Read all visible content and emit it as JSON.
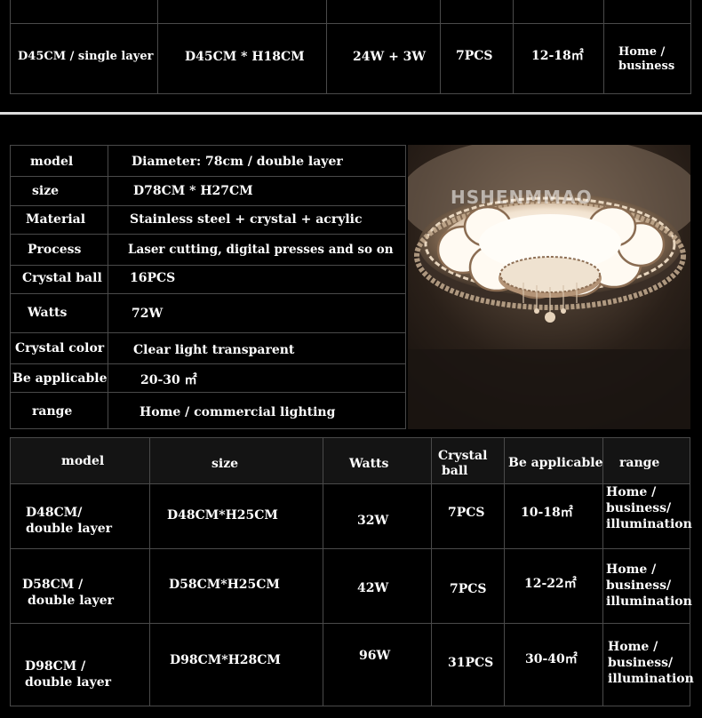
{
  "top_row": {
    "model": "D45CM / single layer",
    "size": "D45CM * H18CM",
    "watts": "24W + 3W",
    "crystal_ball": "7PCS",
    "applicable": "12-18㎡",
    "range_line1": "Home /",
    "range_line2": "business"
  },
  "spec": {
    "model": {
      "label": "model",
      "value": "Diameter: 78cm / double layer"
    },
    "size": {
      "label": "size",
      "value": "D78CM * H27CM"
    },
    "material": {
      "label": "Material",
      "value": "Stainless steel + crystal + acrylic"
    },
    "process": {
      "label": "Process",
      "value": "Laser cutting, digital presses and so on"
    },
    "crystal_ball": {
      "label": "Crystal ball",
      "value": "16PCS"
    },
    "watts": {
      "label": "Watts",
      "value": "72W"
    },
    "crystal_color": {
      "label": "Crystal color",
      "value": "Clear light transparent"
    },
    "applicable": {
      "label": "Be applicable",
      "value": "20-30 ㎡"
    },
    "range": {
      "label": "range",
      "value": "Home / commercial lighting"
    }
  },
  "photo": {
    "watermark": "HSHENMMAO"
  },
  "table": {
    "headers": {
      "model": "model",
      "size": "size",
      "watts": "Watts",
      "crystal_line1": "Crystal",
      "crystal_line2": "ball",
      "applicable": "Be applicable",
      "range": "range"
    },
    "rows": [
      {
        "model1": "D48CM/",
        "model2": "double layer",
        "size": "D48CM*H25CM",
        "watts": "32W",
        "crystal": "7PCS",
        "applicable": "10-18㎡",
        "range1": "Home /",
        "range2": "business/",
        "range3": "illumination"
      },
      {
        "model1": "D58CM /",
        "model2": "double layer",
        "size": "D58CM*H25CM",
        "watts": "42W",
        "crystal": "7PCS",
        "applicable": "12-22㎡",
        "range1": "Home /",
        "range2": "business/",
        "range3": "illumination"
      },
      {
        "model1": "D98CM /",
        "model2": "double layer",
        "size": "D98CM*H28CM",
        "watts": "96W",
        "crystal": "31PCS",
        "applicable": "30-40㎡",
        "range1": "Home /",
        "range2": "business/",
        "range3": "illumination"
      }
    ]
  }
}
